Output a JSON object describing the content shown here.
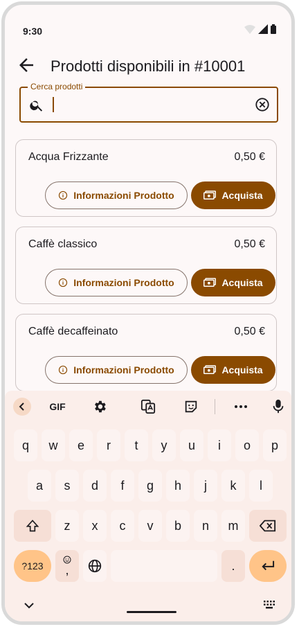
{
  "status": {
    "time": "9:30"
  },
  "header": {
    "title": "Prodotti disponibili in #10001"
  },
  "search": {
    "label": "Cerca prodotti",
    "value": "",
    "placeholder": ""
  },
  "buttons": {
    "info_label": "Informazioni Prodotto",
    "buy_label": "Acquista"
  },
  "products": [
    {
      "name": "Acqua Frizzante",
      "price": "0,50 €"
    },
    {
      "name": "Caffè classico",
      "price": "0,50 €"
    },
    {
      "name": "Caffè decaffeinato",
      "price": "0,50 €"
    }
  ],
  "keyboard": {
    "toolbar": {
      "gif": "GIF"
    },
    "row1": [
      "q",
      "w",
      "e",
      "r",
      "t",
      "y",
      "u",
      "i",
      "o",
      "p"
    ],
    "row2": [
      "a",
      "s",
      "d",
      "f",
      "g",
      "h",
      "j",
      "k",
      "l"
    ],
    "row3": [
      "z",
      "x",
      "c",
      "v",
      "b",
      "n",
      "m"
    ],
    "symbols": "?123",
    "emoji_comma": ",",
    "period": "."
  },
  "colors": {
    "primary": "#8a4a00",
    "keyboard_bg": "#fbeeea",
    "accent_key": "#ffc488"
  }
}
